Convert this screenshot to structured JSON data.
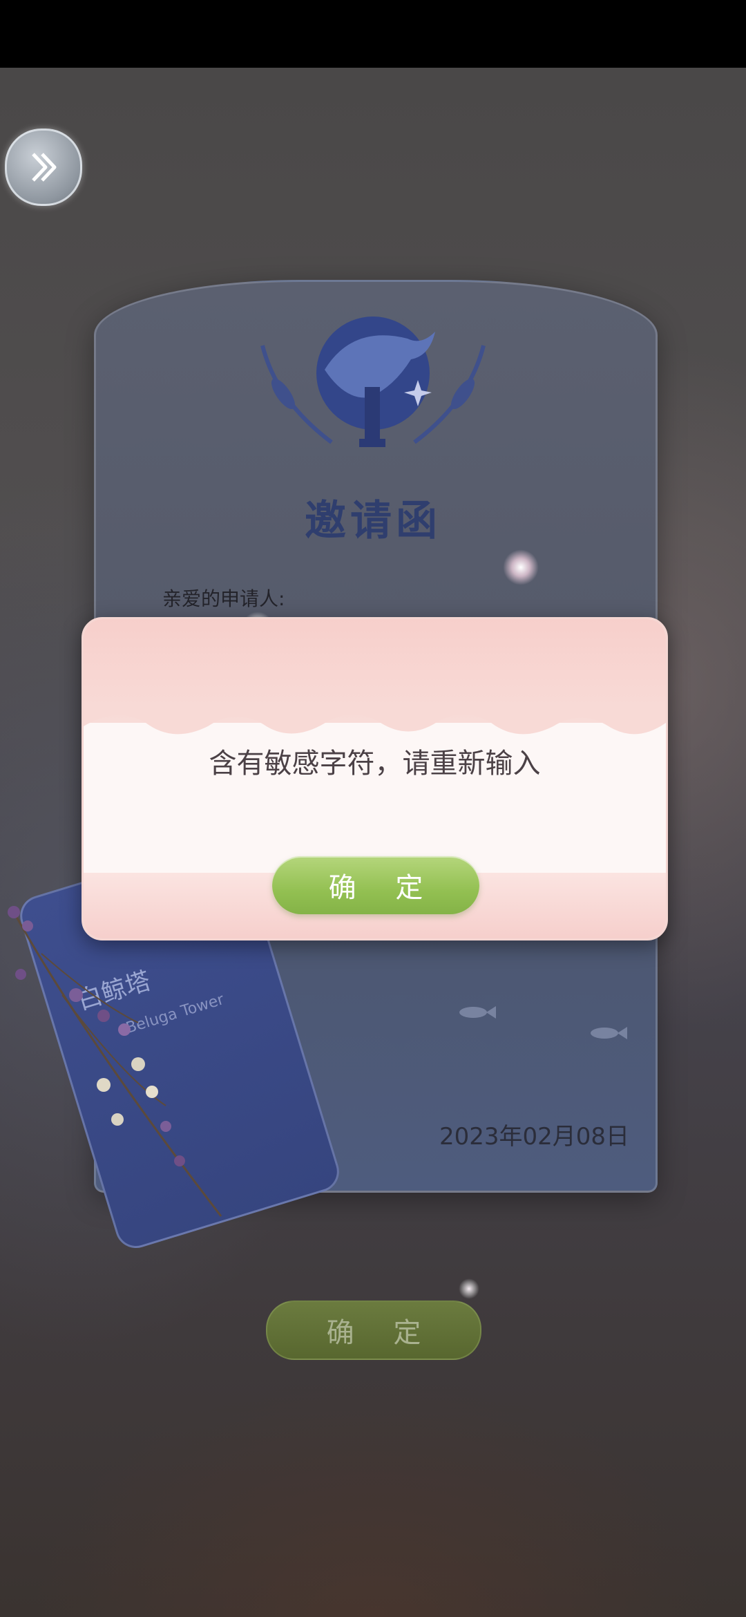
{
  "screen": {
    "skip_icon": "double-chevron-right-icon"
  },
  "invitation": {
    "title": "邀请函",
    "greeting": "亲爱的申请人:",
    "date": "2023年02月08日",
    "ticket_name": "白鲸塔",
    "ticket_subtitle": "Beluga Tower"
  },
  "bottom": {
    "confirm_label": "确 定"
  },
  "dialog": {
    "message": "含有敏感字符，请重新输入",
    "confirm_label": "确 定"
  },
  "colors": {
    "dialog_button": "#93c052",
    "card_title": "#2f3e6e",
    "dialog_top": "#f7cfcb"
  }
}
